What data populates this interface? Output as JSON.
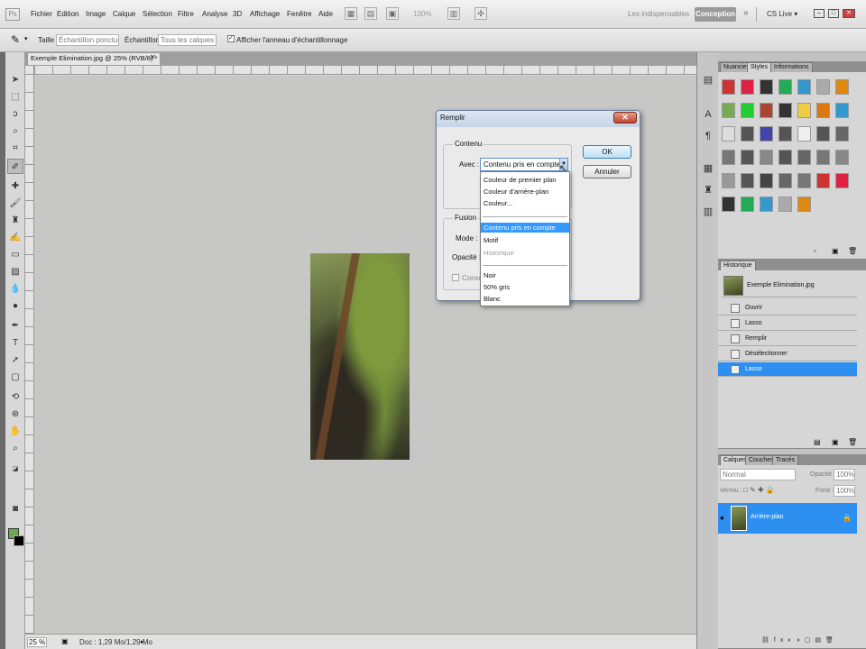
{
  "menubar": {
    "logo": "Ps",
    "items": [
      "Fichier",
      "Edition",
      "Image",
      "Calque",
      "Sélection",
      "Filtre",
      "Analyse",
      "3D",
      "Affichage",
      "Fenêtre",
      "Aide"
    ],
    "zoom": "100%",
    "workspace_other": "Les indispensables",
    "workspace_active": "Conception",
    "more": "»",
    "cs_live": "CS Live ▾"
  },
  "options": {
    "taille_label": "Taille :",
    "taille_value": "Échantillon ponctuel",
    "echantillon_label": "Échantillon :",
    "echantillon_value": "Tous les calques",
    "check_label": "Afficher l'anneau d'échantillonnage"
  },
  "document": {
    "tab_title": "Exemple Elimination.jpg @ 25% (RVB/8) *",
    "zoom": "25 %",
    "info": "Doc : 1,29 Mo/1,29 Mo"
  },
  "panels": {
    "swatches_tabs": [
      "Nuancier",
      "Styles",
      "Informations"
    ],
    "history_tab": "Historique",
    "history_snapshot": "Exemple Elimination.jpg",
    "history_items": [
      "Ouvrir",
      "Lasso",
      "Remplir",
      "Désélectionner",
      "Lasso"
    ],
    "layers_tabs": [
      "Calques",
      "Couches",
      "Tracés"
    ],
    "blend_mode": "Normal",
    "opacity_label": "Opacité :",
    "opacity_value": "100%",
    "lock_label": "Verrou :",
    "fill_label": "Fond :",
    "fill_value": "100%",
    "layer_name": "Arrière-plan"
  },
  "dialog": {
    "title": "Remplir",
    "close": "✕",
    "contenu_label": "Contenu",
    "avec_label": "Avec :",
    "avec_value": "Contenu pris en compte",
    "fusion_label": "Fusion",
    "mode_label": "Mode :",
    "opacite_label": "Opacité :",
    "conserver_label": "Conser",
    "ok": "OK",
    "annuler": "Annuler"
  },
  "dropdown": {
    "group1": [
      "Couleur de premier plan",
      "Couleur d'arrière-plan",
      "Couleur..."
    ],
    "group2": [
      "Contenu pris en compte",
      "Motif",
      "Historique"
    ],
    "group3": [
      "Noir",
      "50% gris",
      "Blanc"
    ]
  },
  "colors": {
    "foreground": "#6aa84f",
    "background": "#000000",
    "selection": "#3399ff"
  }
}
